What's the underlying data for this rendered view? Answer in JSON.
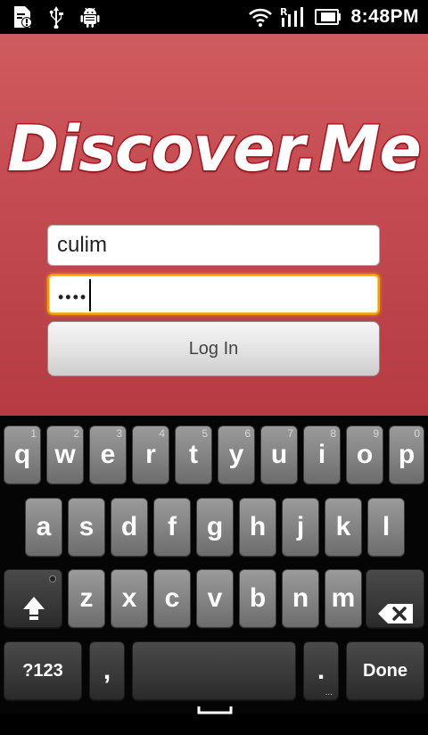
{
  "status_bar": {
    "time": "8:48PM",
    "icons": [
      "sd-card-warning-icon",
      "usb-icon",
      "android-debug-icon",
      "wifi-icon",
      "roaming-signal-icon",
      "battery-icon"
    ]
  },
  "app": {
    "logo_text": "Discover.Me",
    "username_value": "culim",
    "password_mask": "••••",
    "login_label": "Log In",
    "colors": {
      "background_top": "#cf5c5f",
      "background_bottom": "#b63b43",
      "logo_outline": "#b4151f",
      "focus_ring": "#f2a000"
    }
  },
  "keyboard": {
    "row1": [
      {
        "label": "q",
        "hint": "1"
      },
      {
        "label": "w",
        "hint": "2"
      },
      {
        "label": "e",
        "hint": "3"
      },
      {
        "label": "r",
        "hint": "4"
      },
      {
        "label": "t",
        "hint": "5"
      },
      {
        "label": "y",
        "hint": "6"
      },
      {
        "label": "u",
        "hint": "7"
      },
      {
        "label": "i",
        "hint": "8"
      },
      {
        "label": "o",
        "hint": "9"
      },
      {
        "label": "p",
        "hint": "0"
      }
    ],
    "row2": [
      "a",
      "s",
      "d",
      "f",
      "g",
      "h",
      "j",
      "k",
      "l"
    ],
    "row3": [
      "z",
      "x",
      "c",
      "v",
      "b",
      "n",
      "m"
    ],
    "row4": {
      "symbols": "?123",
      "comma": ",",
      "period": ".",
      "done": "Done"
    },
    "special_icons": {
      "shift": "shift-arrow-icon",
      "delete": "backspace-icon",
      "space": "space-bar-icon"
    }
  }
}
